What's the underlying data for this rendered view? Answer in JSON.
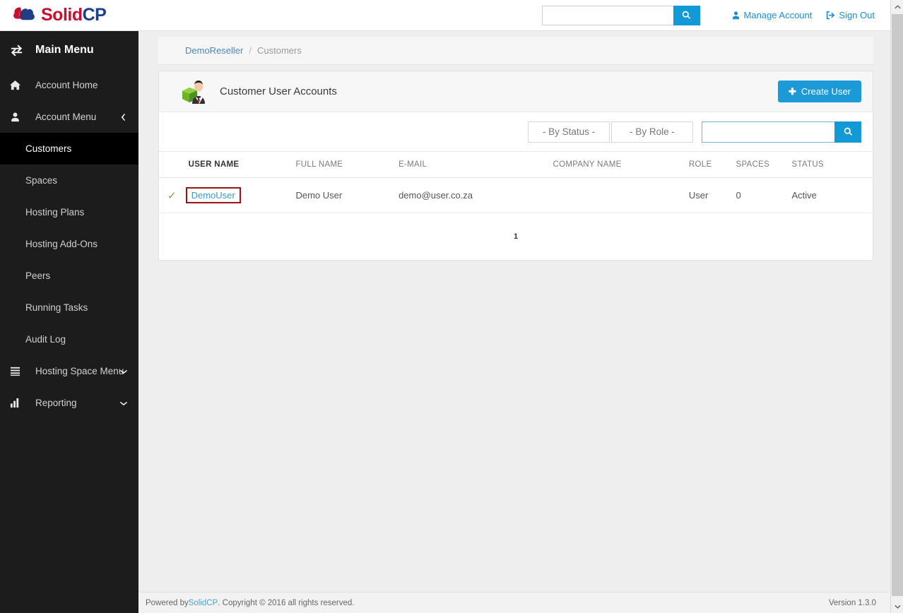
{
  "header": {
    "logo_solid": "Solid",
    "logo_cp": "CP",
    "search_placeholder": "",
    "search_value": "",
    "search_icon": "search-icon",
    "manage_account": "Manage Account",
    "sign_out": "Sign Out"
  },
  "sidebar": {
    "title": "Main Menu",
    "title_icon": "exchange-arrows-icon",
    "items": [
      {
        "label": "Account Home",
        "icon": "home-icon",
        "type": "top",
        "active": false
      },
      {
        "label": "Account Menu",
        "icon": "user-icon",
        "type": "top",
        "active": false,
        "chevron": "chevron-left-icon"
      },
      {
        "label": "Customers",
        "type": "sub",
        "active": true
      },
      {
        "label": "Spaces",
        "type": "sub",
        "active": false
      },
      {
        "label": "Hosting Plans",
        "type": "sub",
        "active": false
      },
      {
        "label": "Hosting Add-Ons",
        "type": "sub",
        "active": false
      },
      {
        "label": "Peers",
        "type": "sub",
        "active": false
      },
      {
        "label": "Running Tasks",
        "type": "sub",
        "active": false
      },
      {
        "label": "Audit Log",
        "type": "sub",
        "active": false
      },
      {
        "label": "Hosting Space Menu",
        "icon": "list-icon",
        "type": "top",
        "active": false,
        "chevron": "chevron-down-icon"
      },
      {
        "label": "Reporting",
        "icon": "bar-chart-icon",
        "type": "top",
        "active": false,
        "chevron": "chevron-down-icon"
      }
    ]
  },
  "breadcrumb": {
    "parent": "DemoReseller",
    "separator": "/",
    "current": "Customers"
  },
  "card": {
    "title": "Customer User Accounts",
    "title_icon": "green-box-businessman-icon",
    "create_button": "Create User",
    "create_button_icon": "plus-icon",
    "create_button_color": "#1b9ad7"
  },
  "filters": {
    "by_status": "- By Status -",
    "by_role": "- By Role -",
    "search_value": "",
    "search_placeholder": "",
    "search_icon": "search-icon"
  },
  "table": {
    "columns": [
      "",
      "USER NAME",
      "FULL NAME",
      "E-MAIL",
      "COMPANY NAME",
      "ROLE",
      "SPACES",
      "STATUS"
    ],
    "rows": [
      {
        "selected_icon": "check-icon",
        "user_name": "DemoUser",
        "full_name": "Demo User",
        "email": "demo@user.co.za",
        "company_name": "",
        "role": "User",
        "spaces": "0",
        "status": "Active",
        "highlighted": true,
        "highlight_color": "#9e1316"
      }
    ]
  },
  "pagination": {
    "current_page": "1"
  },
  "footer": {
    "powered_by_prefix": "Powered by ",
    "brand": "SolidCP",
    "copyright": ". Copyright © 2016 all rights reserved.",
    "version": "Version 1.3.0"
  }
}
